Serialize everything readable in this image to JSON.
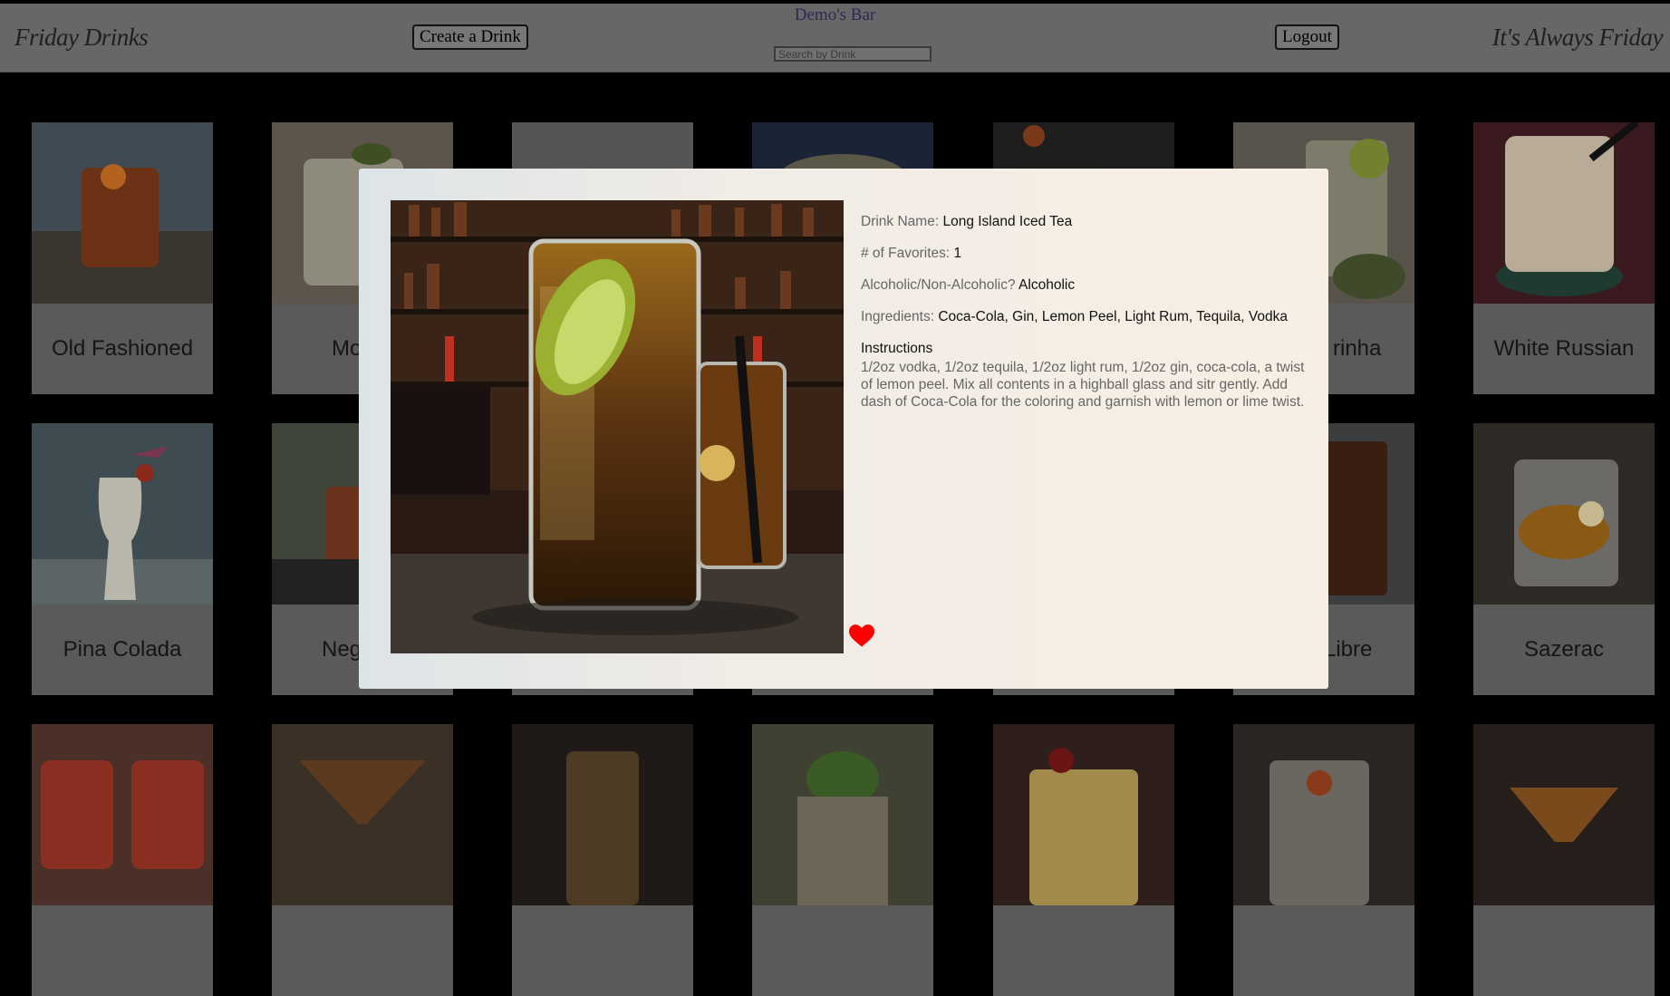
{
  "header": {
    "brand_left": "Friday Drinks",
    "brand_right": "It's Always Friday",
    "bar_title": "Demo's Bar",
    "create_label": "Create a Drink",
    "logout_label": "Logout",
    "search_placeholder": "Search by Drink"
  },
  "drinks": [
    "Old Fashioned",
    "Mo",
    "",
    "",
    "",
    "rinha",
    "White Russian",
    "Pina Colada",
    "Neg",
    "",
    "",
    "",
    "Libre",
    "Sazerac"
  ],
  "modal": {
    "name_label": "Drink Name:",
    "name_value": "Long Island Iced Tea",
    "favorites_label": "# of Favorites:",
    "favorites_value": "1",
    "alcoholic_label": "Alcoholic/Non-Alcoholic?",
    "alcoholic_value": "Alcoholic",
    "ingredients_label": "Ingredients:",
    "ingredients_value": "Coca-Cola, Gin, Lemon Peel, Light Rum, Tequila, Vodka",
    "instructions_label": "Instructions",
    "instructions_text": "1/2oz vodka, 1/2oz tequila, 1/2oz light rum, 1/2oz gin, coca-cola, a twist of lemon peel. Mix all contents in a highball glass and sitr gently. Add dash of Coca-Cola for the coloring and garnish with lemon or lime twist."
  },
  "colors": {
    "heart": "#ff0000",
    "overlay": "#000000"
  }
}
